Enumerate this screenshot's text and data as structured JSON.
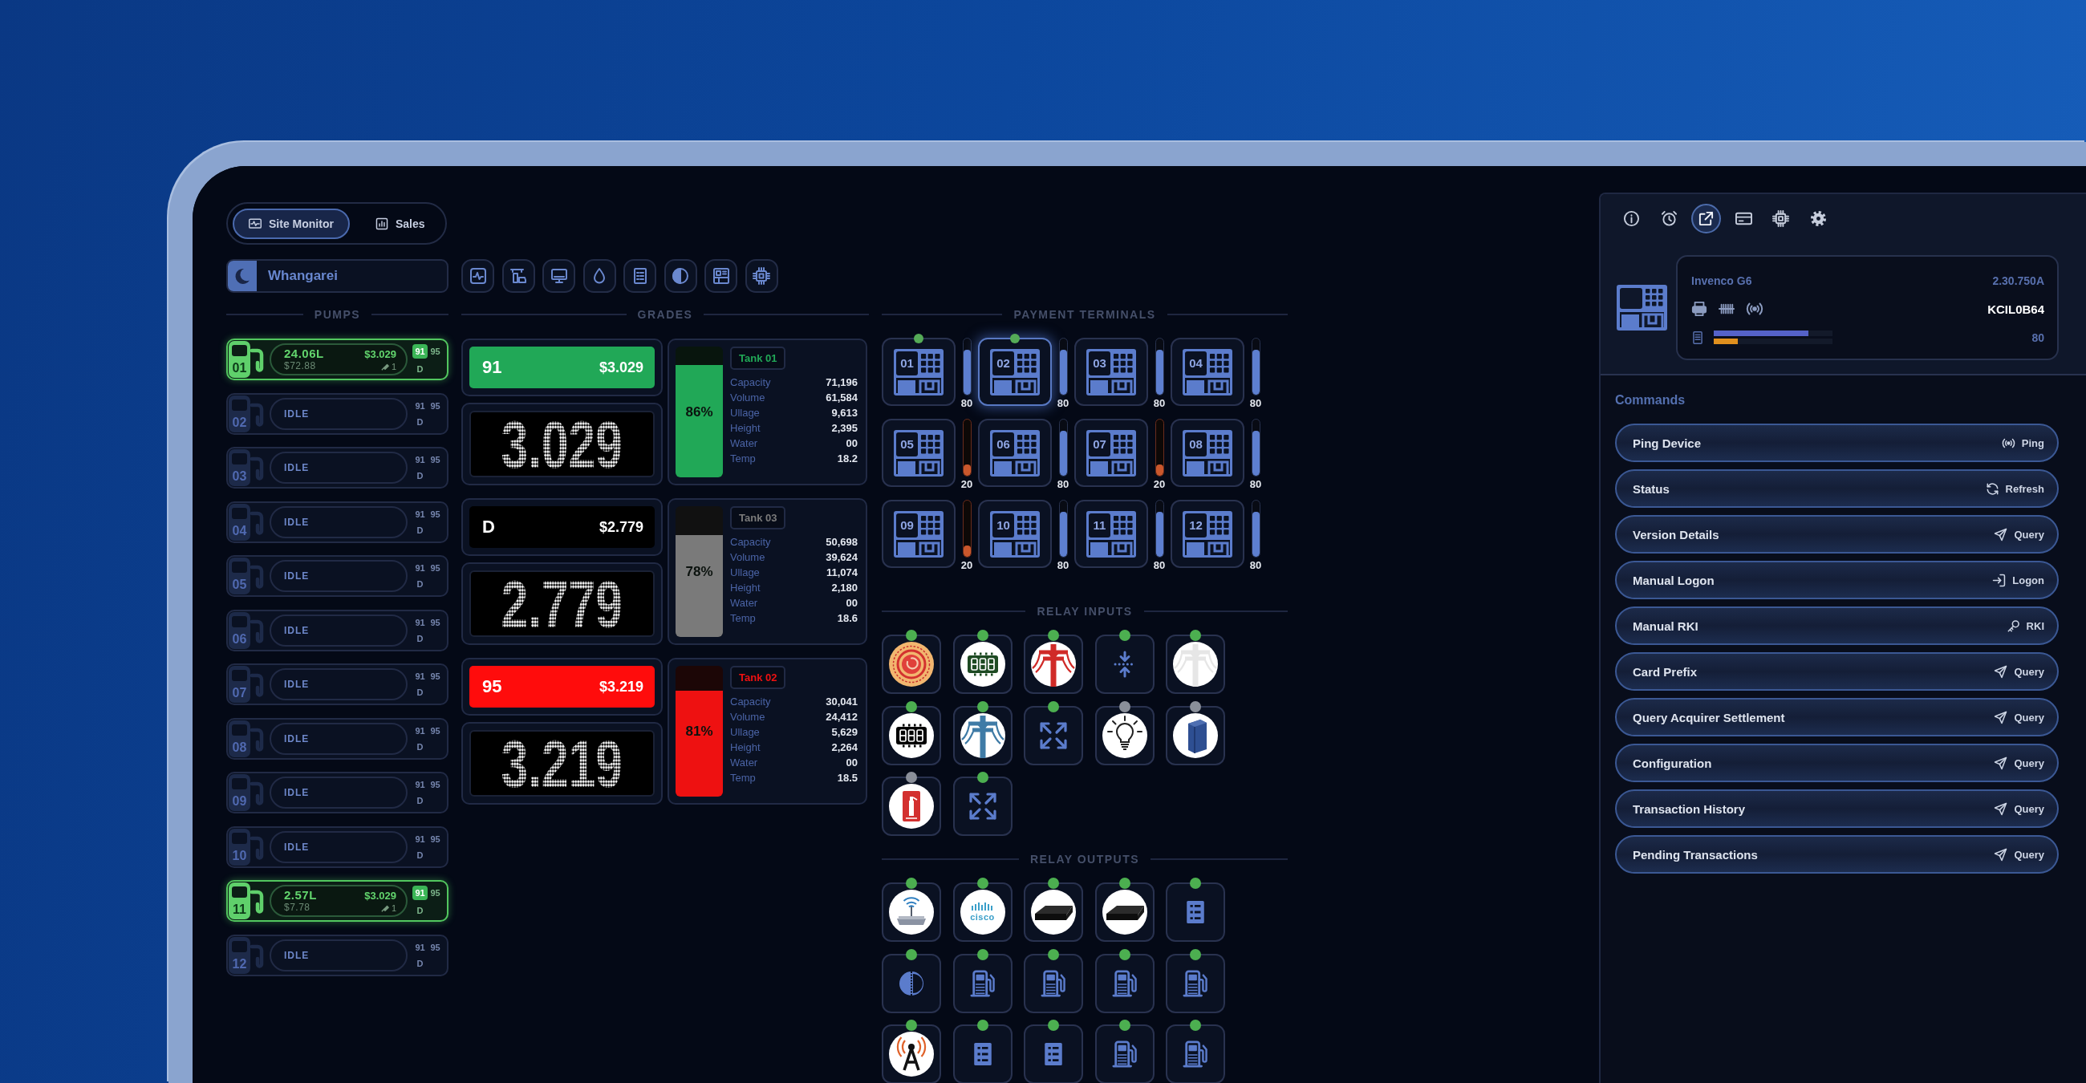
{
  "tabs": [
    {
      "label": "Site Monitor",
      "kind": "site-monitor",
      "selected": true
    },
    {
      "label": "Sales",
      "kind": "chart",
      "selected": false
    }
  ],
  "site": {
    "name": "Whangarei"
  },
  "toolbar": [
    {
      "kind": "pulse"
    },
    {
      "kind": "station"
    },
    {
      "kind": "desktop"
    },
    {
      "kind": "droplet"
    },
    {
      "kind": "list"
    },
    {
      "kind": "half-circle"
    },
    {
      "kind": "terminal"
    },
    {
      "kind": "chip"
    }
  ],
  "pumps": {
    "title": "PUMPS",
    "items": [
      {
        "number": "01",
        "kind": "delivering",
        "volume": "24.06L",
        "amount": "$72.88",
        "price": "$3.029",
        "nozzle": "1",
        "grades": [
          {
            "label": "91",
            "selected": true
          },
          {
            "label": "95",
            "selected": false
          },
          {
            "label": "D",
            "selected": false
          }
        ]
      },
      {
        "number": "02",
        "kind": "idle",
        "status": "IDLE",
        "grades": [
          {
            "label": "91",
            "selected": false
          },
          {
            "label": "95",
            "selected": false
          },
          {
            "label": "D",
            "selected": false
          }
        ]
      },
      {
        "number": "03",
        "kind": "idle",
        "status": "IDLE",
        "grades": [
          {
            "label": "91",
            "selected": false
          },
          {
            "label": "95",
            "selected": false
          },
          {
            "label": "D",
            "selected": false
          }
        ]
      },
      {
        "number": "04",
        "kind": "idle",
        "status": "IDLE",
        "grades": [
          {
            "label": "91",
            "selected": false
          },
          {
            "label": "95",
            "selected": false
          },
          {
            "label": "D",
            "selected": false
          }
        ]
      },
      {
        "number": "05",
        "kind": "idle",
        "status": "IDLE",
        "grades": [
          {
            "label": "91",
            "selected": false
          },
          {
            "label": "95",
            "selected": false
          },
          {
            "label": "D",
            "selected": false
          }
        ]
      },
      {
        "number": "06",
        "kind": "idle",
        "status": "IDLE",
        "grades": [
          {
            "label": "91",
            "selected": false
          },
          {
            "label": "95",
            "selected": false
          },
          {
            "label": "D",
            "selected": false
          }
        ]
      },
      {
        "number": "07",
        "kind": "idle",
        "status": "IDLE",
        "grades": [
          {
            "label": "91",
            "selected": false
          },
          {
            "label": "95",
            "selected": false
          },
          {
            "label": "D",
            "selected": false
          }
        ]
      },
      {
        "number": "08",
        "kind": "idle",
        "status": "IDLE",
        "grades": [
          {
            "label": "91",
            "selected": false
          },
          {
            "label": "95",
            "selected": false
          },
          {
            "label": "D",
            "selected": false
          }
        ]
      },
      {
        "number": "09",
        "kind": "idle",
        "status": "IDLE",
        "grades": [
          {
            "label": "91",
            "selected": false
          },
          {
            "label": "95",
            "selected": false
          },
          {
            "label": "D",
            "selected": false
          }
        ]
      },
      {
        "number": "10",
        "kind": "idle",
        "status": "IDLE",
        "grades": [
          {
            "label": "91",
            "selected": false
          },
          {
            "label": "95",
            "selected": false
          },
          {
            "label": "D",
            "selected": false
          }
        ]
      },
      {
        "number": "11",
        "kind": "delivering",
        "volume": "2.57L",
        "amount": "$7.78",
        "price": "$3.029",
        "nozzle": "1",
        "grades": [
          {
            "label": "91",
            "selected": true
          },
          {
            "label": "95",
            "selected": false
          },
          {
            "label": "D",
            "selected": false
          }
        ]
      },
      {
        "number": "12",
        "kind": "idle",
        "status": "IDLE",
        "grades": [
          {
            "label": "91",
            "selected": false
          },
          {
            "label": "95",
            "selected": false
          },
          {
            "label": "D",
            "selected": false
          }
        ]
      }
    ]
  },
  "grades": {
    "title": "GRADES",
    "items": [
      {
        "grade": "91",
        "price": "$3.029",
        "display": "3.029",
        "color": "#21a857",
        "tank": {
          "label": "Tank 01",
          "level": 0.86,
          "percent": "86%",
          "color": "#21a857",
          "rows": [
            {
              "label": "Capacity",
              "value": "71,196"
            },
            {
              "label": "Volume",
              "value": "61,584"
            },
            {
              "label": "Ullage",
              "value": "9,613"
            },
            {
              "label": "Height",
              "value": "2,395"
            },
            {
              "label": "Water",
              "value": "00"
            },
            {
              "label": "Temp",
              "value": "18.2"
            }
          ]
        }
      },
      {
        "grade": "D",
        "price": "$2.779",
        "display": "2.779",
        "color": "#000000",
        "tank": {
          "label": "Tank 03",
          "level": 0.78,
          "percent": "78%",
          "color": "#7a7a7a",
          "rows": [
            {
              "label": "Capacity",
              "value": "50,698"
            },
            {
              "label": "Volume",
              "value": "39,624"
            },
            {
              "label": "Ullage",
              "value": "11,074"
            },
            {
              "label": "Height",
              "value": "2,180"
            },
            {
              "label": "Water",
              "value": "00"
            },
            {
              "label": "Temp",
              "value": "18.6"
            }
          ]
        }
      },
      {
        "grade": "95",
        "price": "$3.219",
        "display": "3.219",
        "color": "#ff0c0c",
        "tank": {
          "label": "Tank 02",
          "level": 0.81,
          "percent": "81%",
          "color": "#ee1111",
          "rows": [
            {
              "label": "Capacity",
              "value": "30,041"
            },
            {
              "label": "Volume",
              "value": "24,412"
            },
            {
              "label": "Ullage",
              "value": "5,629"
            },
            {
              "label": "Height",
              "value": "2,264"
            },
            {
              "label": "Water",
              "value": "00"
            },
            {
              "label": "Temp",
              "value": "18.5"
            }
          ]
        }
      }
    ]
  },
  "payment_terminals": {
    "title": "PAYMENT TERMINALS",
    "items": [
      {
        "number": "01",
        "online": true,
        "selected": false,
        "level": 0.8,
        "reading": "80"
      },
      {
        "number": "02",
        "online": true,
        "selected": true,
        "level": 0.8,
        "reading": "80"
      },
      {
        "number": "03",
        "online": false,
        "selected": false,
        "level": 0.8,
        "reading": "80"
      },
      {
        "number": "04",
        "online": false,
        "selected": false,
        "level": 0.8,
        "reading": "80"
      },
      {
        "number": "05",
        "online": false,
        "selected": false,
        "level": 0.2,
        "reading": "20"
      },
      {
        "number": "06",
        "online": false,
        "selected": false,
        "level": 0.8,
        "reading": "80"
      },
      {
        "number": "07",
        "online": false,
        "selected": false,
        "level": 0.2,
        "reading": "20"
      },
      {
        "number": "08",
        "online": false,
        "selected": false,
        "level": 0.8,
        "reading": "80"
      },
      {
        "number": "09",
        "online": false,
        "selected": false,
        "level": 0.2,
        "reading": "20"
      },
      {
        "number": "10",
        "online": false,
        "selected": false,
        "level": 0.8,
        "reading": "80"
      },
      {
        "number": "11",
        "online": false,
        "selected": false,
        "level": 0.8,
        "reading": "80"
      },
      {
        "number": "12",
        "online": false,
        "selected": false,
        "level": 0.8,
        "reading": "80"
      }
    ]
  },
  "relay_inputs": {
    "title": "RELAY INPUTS",
    "items": [
      {
        "kind": "emergency-stop",
        "active": true
      },
      {
        "kind": "segment-display",
        "color": "#1d4a22",
        "active": true
      },
      {
        "kind": "power-pole",
        "color": "#d02b28",
        "active": true
      },
      {
        "kind": "compress-arrows",
        "active": true
      },
      {
        "kind": "power-pole",
        "color": "#e6e6e6",
        "active": true
      },
      {
        "kind": "segment-display",
        "color": "#000000",
        "active": true
      },
      {
        "kind": "power-pole",
        "color": "#3f7ba6",
        "active": true
      },
      {
        "kind": "expand-arrows",
        "active": true
      },
      {
        "kind": "light-bulb",
        "active": false
      },
      {
        "kind": "cabinet",
        "active": false
      },
      {
        "kind": "fire-extinguisher",
        "active": false
      },
      {
        "kind": "expand-arrows",
        "active": true
      }
    ]
  },
  "relay_outputs": {
    "title": "RELAY OUTPUTS",
    "items": [
      {
        "kind": "router",
        "active": true
      },
      {
        "kind": "logo",
        "logo_text": "cisco",
        "active": true
      },
      {
        "kind": "network-box",
        "active": true
      },
      {
        "kind": "network-box",
        "active": true
      },
      {
        "kind": "list",
        "active": true
      },
      {
        "kind": "half-circle",
        "active": true
      },
      {
        "kind": "fuel-pump",
        "active": true
      },
      {
        "kind": "fuel-pump",
        "active": true
      },
      {
        "kind": "fuel-pump",
        "active": true
      },
      {
        "kind": "fuel-pump",
        "active": true
      },
      {
        "kind": "antenna",
        "active": true
      },
      {
        "kind": "list",
        "active": true
      },
      {
        "kind": "list",
        "active": true
      },
      {
        "kind": "fuel-pump",
        "active": true
      },
      {
        "kind": "fuel-pump",
        "active": true
      }
    ]
  },
  "side_panel": {
    "tabs": [
      {
        "kind": "info",
        "selected": false
      },
      {
        "kind": "alarm",
        "selected": false
      },
      {
        "kind": "external",
        "selected": true
      },
      {
        "kind": "card",
        "selected": false
      },
      {
        "kind": "chip",
        "selected": false
      },
      {
        "kind": "gear",
        "selected": false
      }
    ],
    "device": {
      "model": "Invenco G6",
      "version": "2.30.750A",
      "serial": "KCIL0B64",
      "reading": "80",
      "bars": [
        {
          "level": 0.8,
          "color": "#5562c8"
        },
        {
          "level": 0.2,
          "color": "#e0901e"
        }
      ]
    },
    "commands": {
      "title": "Commands",
      "items": [
        {
          "label": "Ping Device",
          "action": "Ping",
          "kind": "ping"
        },
        {
          "label": "Status",
          "action": "Refresh",
          "kind": "refresh"
        },
        {
          "label": "Version Details",
          "action": "Query",
          "kind": "send"
        },
        {
          "label": "Manual Logon",
          "action": "Logon",
          "kind": "logon"
        },
        {
          "label": "Manual RKI",
          "action": "RKI",
          "kind": "key"
        },
        {
          "label": "Card Prefix",
          "action": "Query",
          "kind": "send"
        },
        {
          "label": "Query Acquirer Settlement",
          "action": "Query",
          "kind": "send"
        },
        {
          "label": "Configuration",
          "action": "Query",
          "kind": "send"
        },
        {
          "label": "Transaction History",
          "action": "Query",
          "kind": "send"
        },
        {
          "label": "Pending Transactions",
          "action": "Query",
          "kind": "send"
        }
      ]
    }
  }
}
